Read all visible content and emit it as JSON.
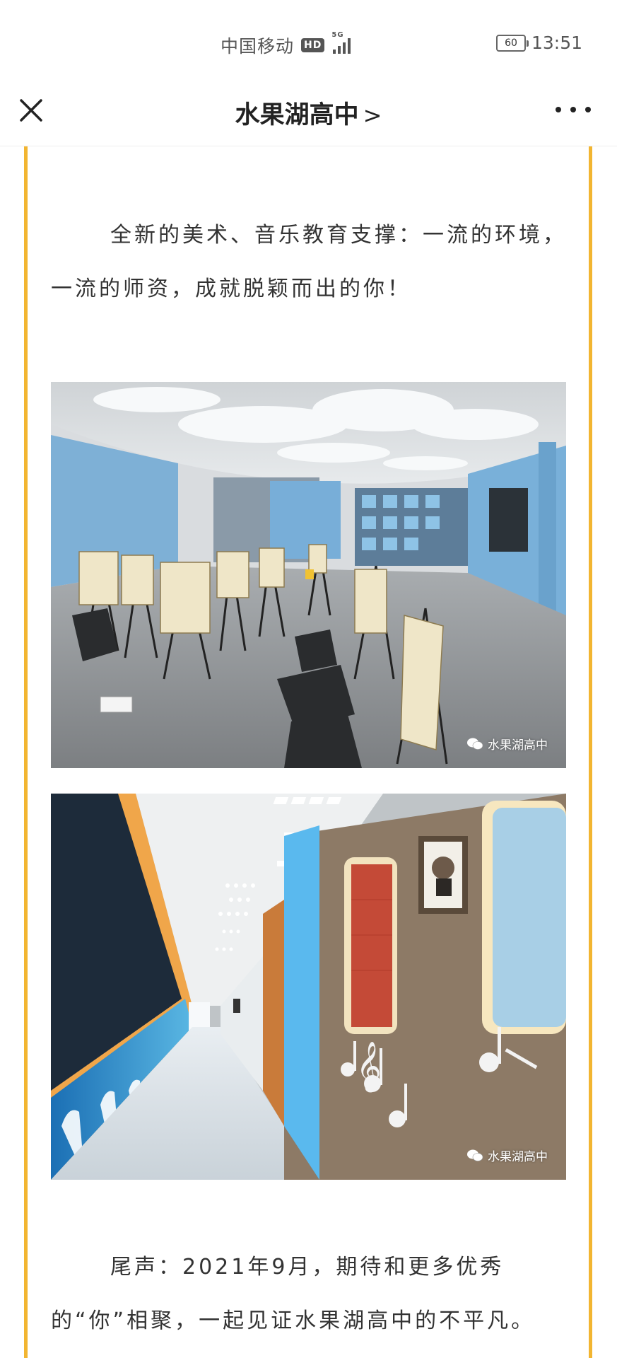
{
  "status_bar": {
    "carrier": "中国移动",
    "hd_badge": "HD",
    "network": "5G",
    "battery": "60",
    "time": "13:51"
  },
  "nav": {
    "title": "水果湖高中",
    "title_chevron": ">",
    "close_icon": "close-icon",
    "more_icon": "more-dots-icon"
  },
  "article": {
    "accent_color": "#f2b531",
    "paragraph_1": "全新的美术、音乐教育支撑：一流的环境，一流的师资，成就脱颖而出的你！",
    "paragraph_2": "尾声：2021年9月，期待和更多优秀的“你”相聚，一起见证水果湖高中的不平凡。",
    "images": [
      {
        "watermark": "水果湖高中"
      },
      {
        "watermark": "水果湖高中"
      }
    ]
  }
}
